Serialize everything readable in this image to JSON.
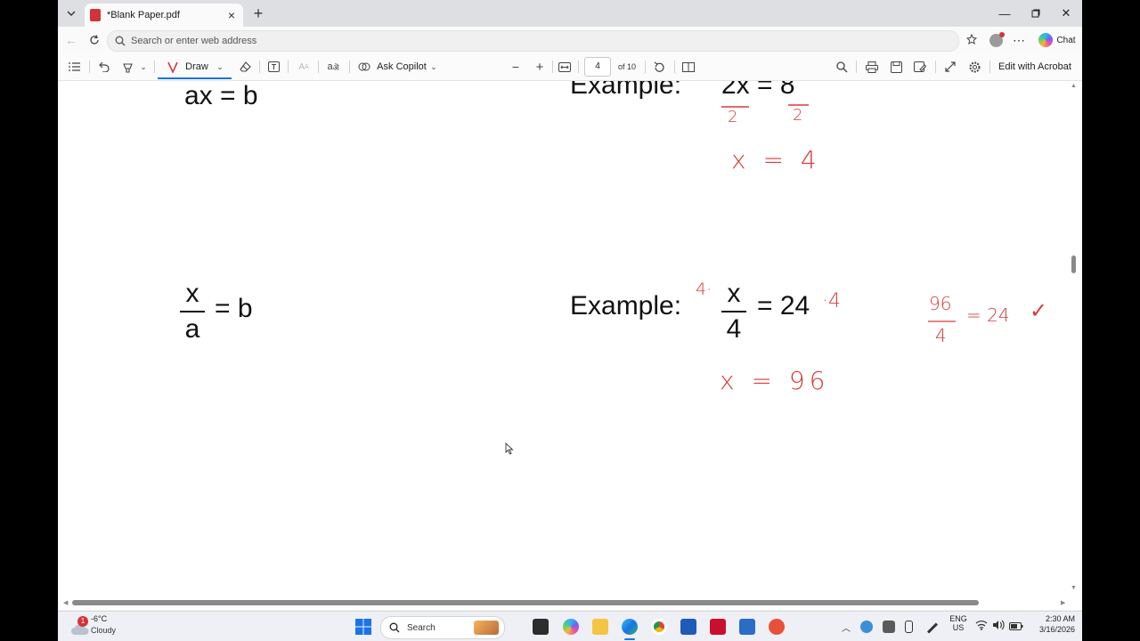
{
  "browser": {
    "tab_title": "*Blank Paper.pdf",
    "address_placeholder": "Search or enter web address",
    "chat_label": "Chat"
  },
  "pdf_toolbar": {
    "draw_label": "Draw",
    "ask_copilot_label": "Ask Copilot",
    "current_page": "4",
    "page_total": "of 10",
    "edit_acrobat_label": "Edit with Acrobat"
  },
  "document": {
    "formula_1": "ax = b",
    "example_1_label": "Example:",
    "example_1_equation": "2x = 8",
    "formula_2_numerator": "x",
    "formula_2_denominator": "a",
    "formula_2_rhs": "= b",
    "example_2_label": "Example:",
    "example_2_numerator": "x",
    "example_2_denominator": "4",
    "example_2_rhs": "= 24",
    "handwriting": {
      "div_left": "2",
      "div_right": "2",
      "solution_1": "x = 4",
      "mult_left": "4·",
      "mult_right": "·4",
      "solution_2": "x = 96",
      "check_numerator": "96",
      "check_denominator": "4",
      "check_result": "= 24",
      "check_mark": "✓"
    }
  },
  "taskbar": {
    "weather_temp": "-6°C",
    "weather_desc": "Cloudy",
    "weather_badge": "1",
    "search_label": "Search",
    "lang_1": "ENG",
    "lang_2": "US",
    "time": "2:30 AM",
    "date": "3/16/2026"
  }
}
